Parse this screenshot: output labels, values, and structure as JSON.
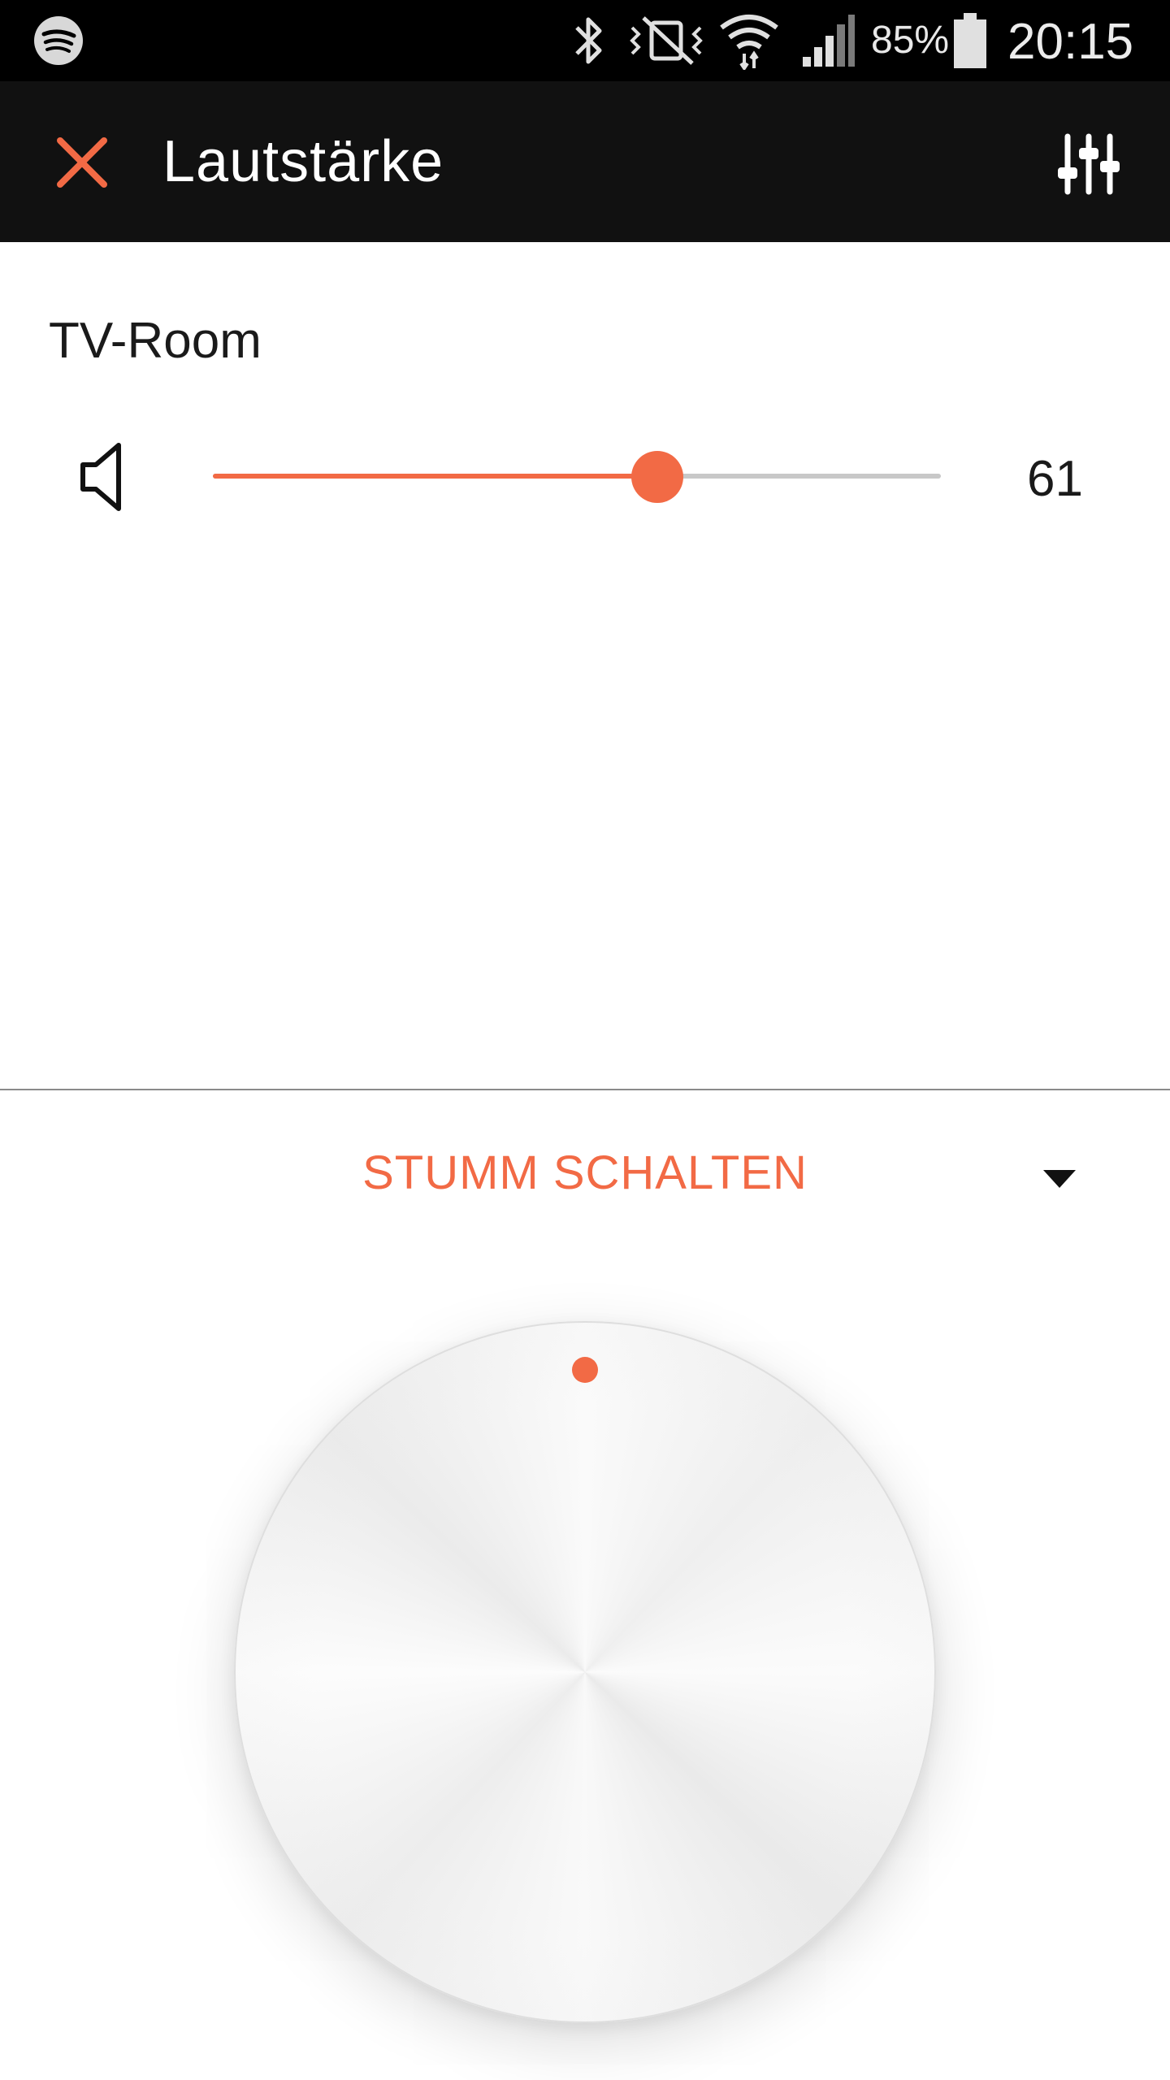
{
  "status_bar": {
    "battery_percent": "85%",
    "time": "20:15",
    "icons": [
      "spotify-icon",
      "bluetooth-icon",
      "vibrate-icon",
      "wifi-icon",
      "signal-icon",
      "battery-icon"
    ]
  },
  "toolbar": {
    "title": "Lautstärke",
    "close_icon": "close-icon",
    "equalizer_icon": "equalizer-icon"
  },
  "room": {
    "name": "TV-Room",
    "volume": "61",
    "volume_fraction": 0.61
  },
  "mute": {
    "label": "STUMM SCHALTEN"
  },
  "colors": {
    "accent": "#f26a45",
    "toolbar_bg": "#111111",
    "status_bg": "#000000"
  }
}
